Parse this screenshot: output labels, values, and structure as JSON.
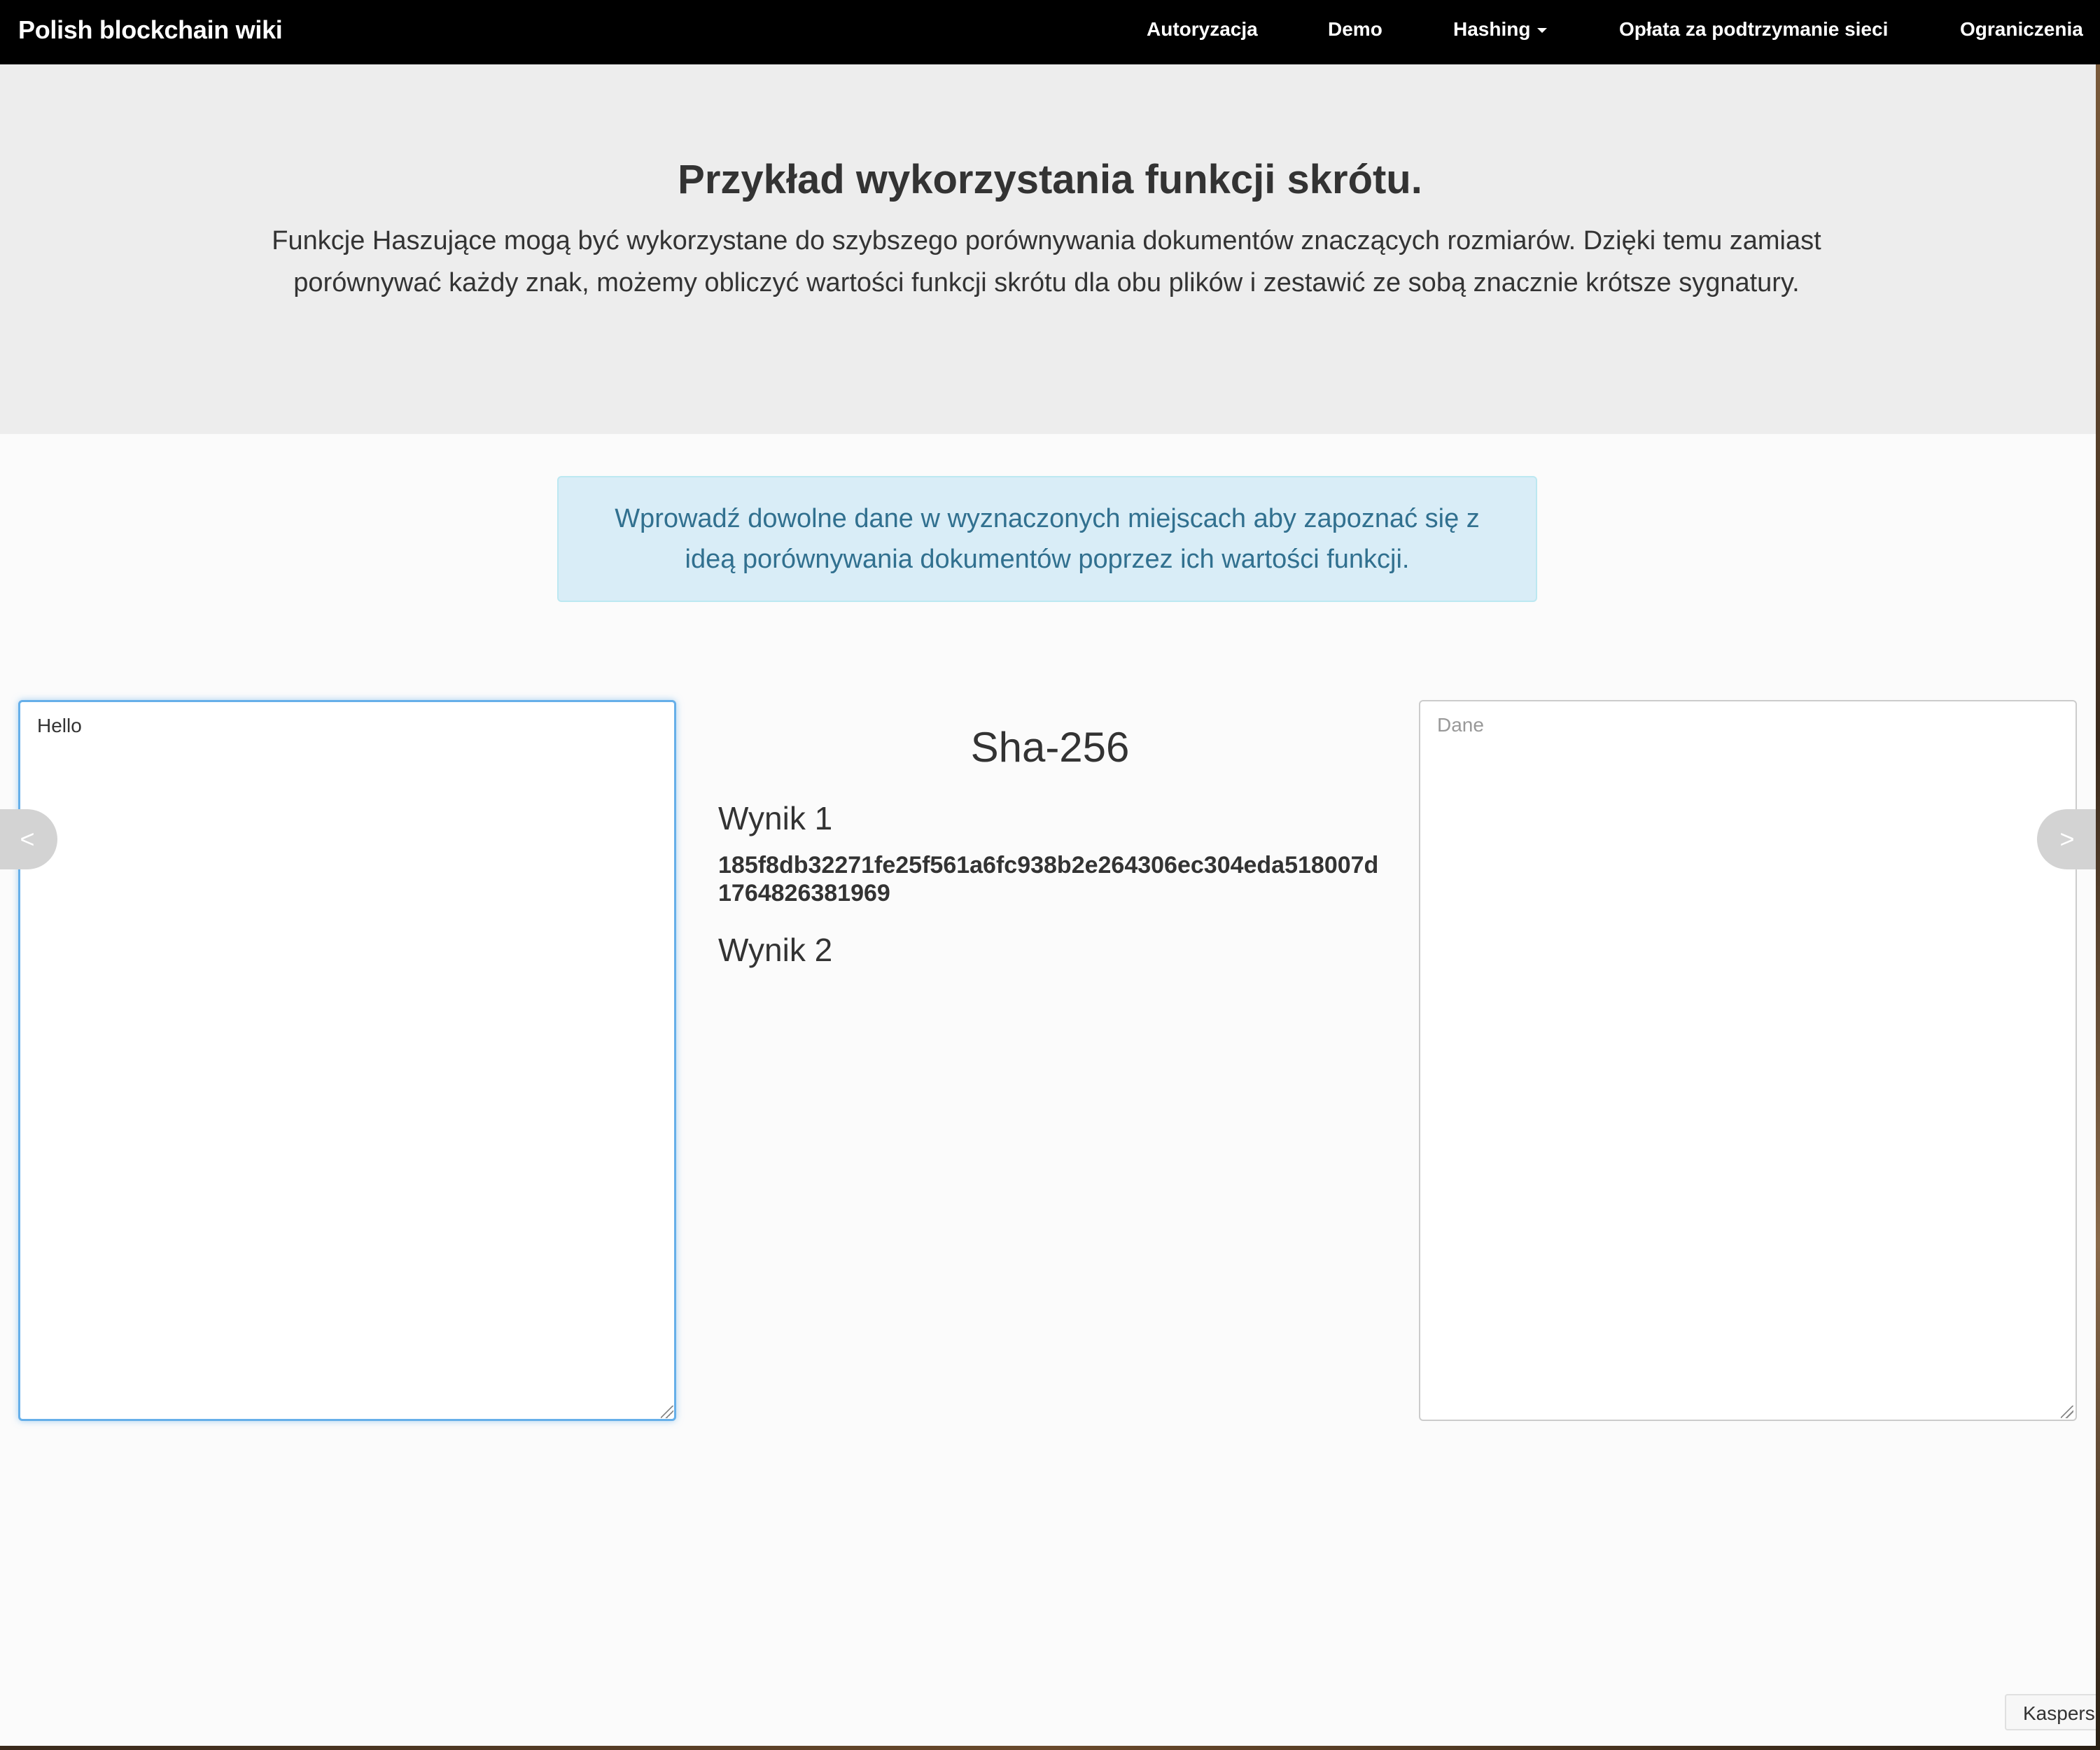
{
  "navbar": {
    "brand": "Polish blockchain wiki",
    "items": [
      {
        "label": "Autoryzacja"
      },
      {
        "label": "Demo"
      },
      {
        "label": "Hashing",
        "dropdown": true
      },
      {
        "label": "Opłata za podtrzymanie sieci"
      },
      {
        "label": "Ograniczenia"
      }
    ]
  },
  "jumbotron": {
    "title": "Przykład wykorzystania funkcji skrótu.",
    "lead": "Funkcje Haszujące mogą być wykorzystane do szybszego porównywania dokumentów znaczących rozmiarów. Dzięki temu zamiast porównywać każdy znak, możemy obliczyć wartości funkcji skrótu dla obu plików i zestawić ze sobą znacznie krótsze sygnatury."
  },
  "alert": {
    "text": "Wprowadź dowolne dane w wyznaczonych miejscach aby zapoznać się z ideą porównywania dokumentów poprzez ich wartości funkcji."
  },
  "input1": {
    "value": "Hello",
    "placeholder": ""
  },
  "input2": {
    "value": "",
    "placeholder": "Dane"
  },
  "results": {
    "algorithm": "Sha-256",
    "result1_label": "Wynik 1",
    "result1_value": "185f8db32271fe25f561a6fc938b2e264306ec304eda518007d1764826381969",
    "result2_label": "Wynik 2",
    "result2_value": ""
  },
  "carousel": {
    "prev": "<",
    "next": ">"
  },
  "extension_badge": "Kaspersky",
  "colors": {
    "navbar_bg": "#000000",
    "jumbotron_bg": "#ededed",
    "alert_bg": "#d9edf7",
    "alert_text": "#31708f",
    "focus_border": "#66afe9"
  }
}
